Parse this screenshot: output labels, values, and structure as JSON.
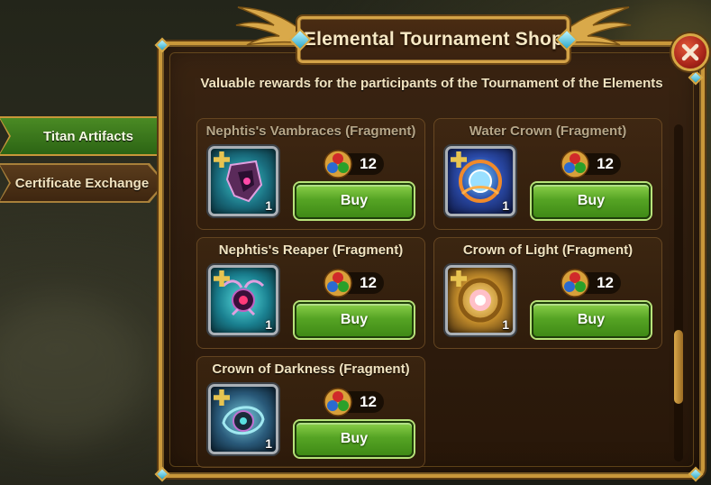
{
  "window": {
    "title": "Elemental Tournament Shop",
    "subtitle": "Valuable rewards for the participants of the Tournament of the Elements",
    "close_icon": "close-icon"
  },
  "tabs": [
    {
      "label": "Titan Artifacts",
      "active": true
    },
    {
      "label": "Certificate Exchange",
      "active": false
    }
  ],
  "currency": {
    "icon": "elemental-currency-icon"
  },
  "items": [
    {
      "name": "Nephtis's Vambraces (Fragment)",
      "price": "12",
      "quantity": "1",
      "buy_label": "Buy",
      "icon": "vambraces-icon",
      "title_dimmed": true
    },
    {
      "name": "Water Crown (Fragment)",
      "price": "12",
      "quantity": "1",
      "buy_label": "Buy",
      "icon": "water-crown-icon",
      "title_dimmed": true
    },
    {
      "name": "Nephtis's Reaper (Fragment)",
      "price": "12",
      "quantity": "1",
      "buy_label": "Buy",
      "icon": "reaper-icon",
      "title_dimmed": false
    },
    {
      "name": "Crown of Light (Fragment)",
      "price": "12",
      "quantity": "1",
      "buy_label": "Buy",
      "icon": "crown-of-light-icon",
      "title_dimmed": false
    },
    {
      "name": "Crown of Darkness (Fragment)",
      "price": "12",
      "quantity": "1",
      "buy_label": "Buy",
      "icon": "crown-of-darkness-icon",
      "title_dimmed": false
    }
  ],
  "scroll": {
    "position_fraction": 0.78,
    "thumb_fraction": 0.22
  },
  "colors": {
    "frame_gold": "#c8973a",
    "panel_brown": "#2f1d0e",
    "buy_green": "#56a424",
    "tab_active_green": "#2c6414"
  }
}
